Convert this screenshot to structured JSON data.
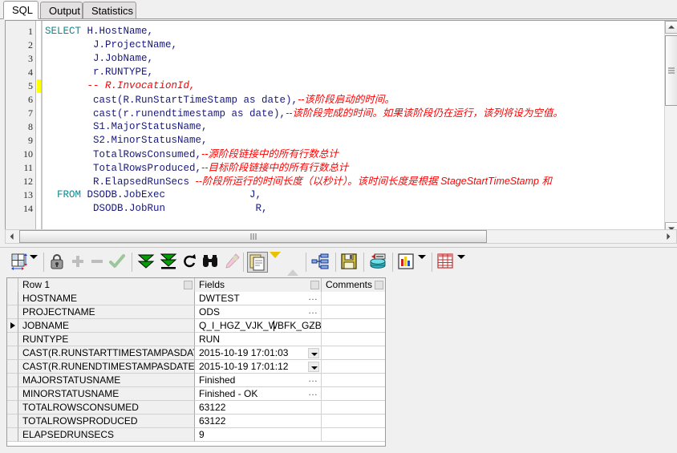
{
  "tabs": [
    {
      "label": "SQL",
      "active": true
    },
    {
      "label": "Output",
      "active": false
    },
    {
      "label": "Statistics",
      "active": false
    }
  ],
  "editor": {
    "line_numbers": [
      "1",
      "2",
      "3",
      "4",
      "5",
      "6",
      "7",
      "8",
      "9",
      "10",
      "11",
      "12",
      "13",
      "14"
    ],
    "lines": [
      {
        "n": "1",
        "kw": "SELECT",
        "code": " H.HostName,",
        "comment": ""
      },
      {
        "n": "2",
        "kw": "",
        "code": "        J.ProjectName,",
        "comment": ""
      },
      {
        "n": "3",
        "kw": "",
        "code": "        J.JobName,",
        "comment": ""
      },
      {
        "n": "4",
        "kw": "",
        "code": "        r.RUNTYPE,",
        "comment": ""
      },
      {
        "n": "5",
        "kw": "",
        "code": "       ",
        "comment": "-- R.InvocationId,"
      },
      {
        "n": "6",
        "kw": "",
        "code": "        cast(R.RunStartTimeStamp as date),",
        "comment": "--该阶段启动的时间。"
      },
      {
        "n": "7",
        "kw": "",
        "code": "        cast(r.runendtimestamp as date),",
        "comment": "--该阶段完成的时间。如果该阶段仍在运行，该列将设为空值。"
      },
      {
        "n": "8",
        "kw": "",
        "code": "        S1.MajorStatusName,",
        "comment": ""
      },
      {
        "n": "9",
        "kw": "",
        "code": "        S2.MinorStatusName,",
        "comment": ""
      },
      {
        "n": "10",
        "kw": "",
        "code": "        TotalRowsConsumed,",
        "comment": "--源阶段链接中的所有行数总计"
      },
      {
        "n": "11",
        "kw": "",
        "code": "        TotalRowsProduced,",
        "comment": "--目标阶段链接中的所有行数总计"
      },
      {
        "n": "12",
        "kw": "",
        "code": "        R.ElapsedRunSecs ",
        "comment": "--阶段所运行的时间长度（以秒计）。该时间长度是根据 StageStartTimeStamp 和"
      },
      {
        "n": "13",
        "kw": "  FROM",
        "code": " DSODB.JobExec              J,",
        "comment": ""
      },
      {
        "n": "14",
        "kw": "",
        "code": "        DSODB.JobRun               R,",
        "comment": ""
      }
    ],
    "change_marker_line": "5",
    "colors": {
      "keyword": "#0b8a8f",
      "identifier": "#19197f",
      "comment": "#ff0000",
      "change_marker": "#ffff00"
    }
  },
  "toolbar": {
    "items": [
      {
        "name": "fit-columns-button",
        "icon": "grid-resize-icon"
      },
      {
        "name": "fit-columns-dropdown",
        "icon": "chevron-down-icon"
      },
      {
        "name": "lock-record-button",
        "icon": "lock-icon"
      },
      {
        "name": "add-record-button",
        "icon": "plus-icon",
        "disabled": true
      },
      {
        "name": "delete-record-button",
        "icon": "minus-icon",
        "disabled": true
      },
      {
        "name": "commit-button",
        "icon": "check-icon",
        "disabled": true
      },
      {
        "name": "next-record-button",
        "icon": "double-down-arrow-icon"
      },
      {
        "name": "last-record-button",
        "icon": "double-down-bar-arrow-icon"
      },
      {
        "name": "refresh-button",
        "icon": "refresh-icon"
      },
      {
        "name": "find-button",
        "icon": "binoculars-icon"
      },
      {
        "name": "highlight-button",
        "icon": "pencil-icon",
        "disabled": true
      },
      {
        "name": "single-record-view-button",
        "icon": "record-card-icon",
        "pressed": true
      },
      {
        "name": "view-mode-dropdown",
        "icon": "caret-down-yellow-icon"
      },
      {
        "name": "collapse-button",
        "icon": "caret-up-gray-icon",
        "disabled": true
      },
      {
        "name": "explain-plan-button",
        "icon": "query-plan-icon"
      },
      {
        "name": "save-button",
        "icon": "floppy-disk-icon"
      },
      {
        "name": "export-db-button",
        "icon": "database-export-icon"
      },
      {
        "name": "chart-button",
        "icon": "bar-chart-icon"
      },
      {
        "name": "chart-dropdown",
        "icon": "chevron-down-icon"
      },
      {
        "name": "grid-view-button",
        "icon": "table-grid-icon"
      },
      {
        "name": "grid-view-dropdown",
        "icon": "chevron-down-icon"
      }
    ]
  },
  "grid": {
    "columns": [
      "Row 1",
      "Fields",
      "Comments"
    ],
    "rows": [
      {
        "field": "HOSTNAME",
        "value": "DWTEST",
        "comment": "",
        "widget": "ellipsis",
        "current": false
      },
      {
        "field": "PROJECTNAME",
        "value": "ODS",
        "comment": "",
        "widget": "ellipsis",
        "current": false
      },
      {
        "field": "JOBNAME",
        "value": "Q_I_HGZ_VJK_WBFK_GZB",
        "comment": "",
        "widget": "ellipsis",
        "current": true
      },
      {
        "field": "RUNTYPE",
        "value": "RUN",
        "comment": "",
        "widget": "none",
        "current": false
      },
      {
        "field": "CAST(R.RUNSTARTTIMESTAMPASDATE",
        "value": "2015-10-19 17:01:03",
        "comment": "",
        "widget": "dropdown",
        "current": false
      },
      {
        "field": "CAST(R.RUNENDTIMESTAMPASDATE)",
        "value": "2015-10-19 17:01:12",
        "comment": "",
        "widget": "dropdown",
        "current": false
      },
      {
        "field": "MAJORSTATUSNAME",
        "value": "Finished",
        "comment": "",
        "widget": "ellipsis",
        "current": false
      },
      {
        "field": "MINORSTATUSNAME",
        "value": "Finished - OK",
        "comment": "",
        "widget": "ellipsis",
        "current": false
      },
      {
        "field": "TOTALROWSCONSUMED",
        "value": "63122",
        "comment": "",
        "widget": "none",
        "current": false
      },
      {
        "field": "TOTALROWSPRODUCED",
        "value": "63122",
        "comment": "",
        "widget": "none",
        "current": false
      },
      {
        "field": "ELAPSEDRUNSECS",
        "value": "9",
        "comment": "",
        "widget": "none",
        "current": false
      }
    ]
  }
}
